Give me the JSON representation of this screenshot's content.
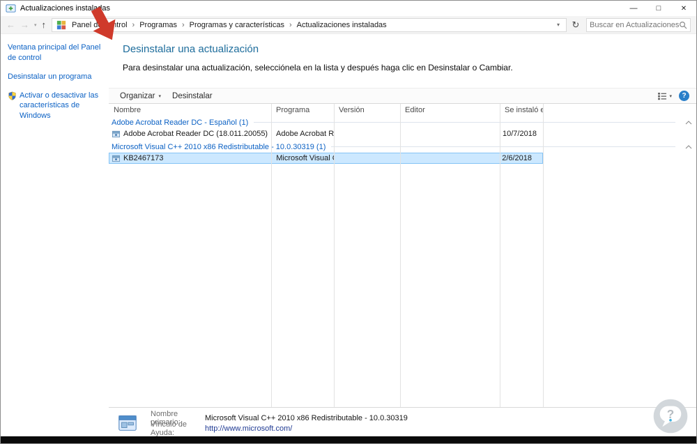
{
  "window": {
    "title": "Actualizaciones instaladas",
    "controls": {
      "minimize": "—",
      "maximize": "□",
      "close": "✕"
    }
  },
  "icons": {
    "back": "←",
    "forward": "→",
    "up": "↑",
    "caret_down": "▾",
    "refresh": "↻",
    "breadcrumb_separator": "›",
    "help": "?"
  },
  "nav": {
    "breadcrumb": [
      "Panel de control",
      "Programas",
      "Programas y características",
      "Actualizaciones instaladas"
    ],
    "search_placeholder": "Buscar en Actualizaciones inst..."
  },
  "sidebar": {
    "items": [
      {
        "label": "Ventana principal del Panel de control"
      },
      {
        "label": "Desinstalar un programa"
      },
      {
        "label": "Activar o desactivar las características de Windows"
      }
    ]
  },
  "main": {
    "heading": "Desinstalar una actualización",
    "description": "Para desinstalar una actualización, selecciónela en la lista y después haga clic en Desinstalar o Cambiar.",
    "toolbar": {
      "organize": "Organizar",
      "uninstall": "Desinstalar"
    },
    "table": {
      "columns": [
        "Nombre",
        "Programa",
        "Versión",
        "Editor",
        "Se instaló el"
      ],
      "groups": [
        {
          "label": "Adobe Acrobat Reader DC - Español (1)",
          "rows": [
            {
              "name": "Adobe Acrobat Reader DC  (18.011.20055)",
              "program": "Adobe Acrobat Rea...",
              "version": "",
              "editor": "",
              "installed_on": "10/7/2018"
            }
          ]
        },
        {
          "label": "Microsoft Visual C++ 2010  x86 Redistributable - 10.0.30319 (1)",
          "rows": [
            {
              "name": "KB2467173",
              "program": "Microsoft Visual C+...",
              "version": "",
              "editor": "",
              "installed_on": "2/6/2018"
            }
          ]
        }
      ]
    },
    "details": {
      "primary_label": "Nombre primario:",
      "primary_value": "Microsoft Visual C++ 2010  x86 Redistributable - 10.0.30319",
      "help_label": "Vínculo de Ayuda:",
      "help_value": "http://www.microsoft.com/"
    }
  },
  "colors": {
    "heading": "#1e6d9c",
    "link": "#0b61c4",
    "selection_bg": "#cce8ff",
    "selection_border": "#84c3f5",
    "annotation_arrow": "#cf3a2b",
    "help_icon": "#2a7fc9"
  }
}
